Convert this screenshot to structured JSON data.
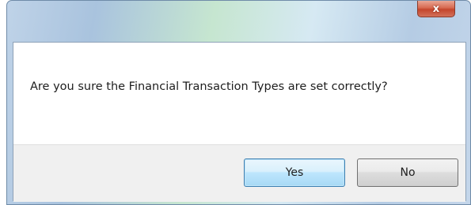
{
  "dialog": {
    "close_glyph": "x",
    "message": "Are you sure the Financial Transaction Types are set correctly?",
    "buttons": {
      "yes_label": "Yes",
      "no_label": "No"
    }
  }
}
